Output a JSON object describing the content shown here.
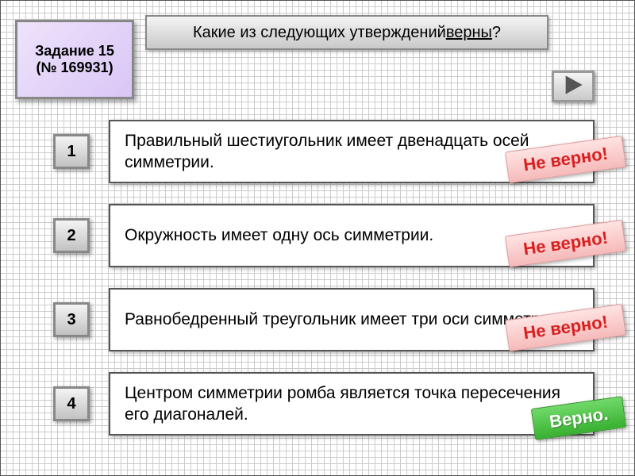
{
  "task": {
    "title": "Задание 15",
    "number": "(№ 169931)"
  },
  "question": {
    "prefix": "Какие из следующих утверждений ",
    "underlined": "верны",
    "suffix": "?"
  },
  "nav": {
    "next": "next"
  },
  "stamps": {
    "incorrect": "Не верно!",
    "correct": "Верно."
  },
  "answers": [
    {
      "num": "1",
      "text": "Правильный шестиугольник имеет двенадцать осей симметрии.",
      "result": "incorrect"
    },
    {
      "num": "2",
      "text": "Окружность имеет одну ось симметрии.",
      "result": "incorrect"
    },
    {
      "num": "3",
      "text": "Равнобедренный треугольник имеет три оси симметрии.",
      "result": "incorrect"
    },
    {
      "num": "4",
      "text": "Центром симметрии ромба является точка пересечения его диагоналей.",
      "result": "correct"
    }
  ]
}
